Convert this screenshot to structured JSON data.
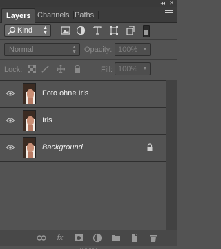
{
  "header": {
    "collapse_glyph": "◂◂",
    "close_glyph": "✕",
    "menu_icon": "panel-menu-icon"
  },
  "tabs": [
    {
      "label": "Layers",
      "active": true
    },
    {
      "label": "Channels",
      "active": false
    },
    {
      "label": "Paths",
      "active": false
    }
  ],
  "filter": {
    "kind_label": "Kind",
    "icons": [
      "pixel-filter-icon",
      "adjustment-filter-icon",
      "type-filter-icon",
      "shape-filter-icon",
      "smart-object-filter-icon"
    ]
  },
  "blend": {
    "mode": "Normal",
    "opacity_label": "Opacity:",
    "opacity_value": "100%"
  },
  "lock": {
    "label": "Lock:",
    "fill_label": "Fill:",
    "fill_value": "100%"
  },
  "layers": [
    {
      "name": "Foto ohne Iris",
      "visible": true,
      "locked": false,
      "italic": false
    },
    {
      "name": "Iris",
      "visible": true,
      "locked": false,
      "italic": false
    },
    {
      "name": "Background",
      "visible": true,
      "locked": true,
      "italic": true
    }
  ],
  "footer": {
    "icons": [
      "link-layers-icon",
      "fx-icon",
      "add-mask-icon",
      "adjustment-layer-icon",
      "new-group-icon",
      "new-layer-icon",
      "delete-layer-icon"
    ],
    "fx_label": "fx"
  },
  "colors": {
    "panel_bg": "#535353",
    "dark_bar": "#3c3c3c",
    "text": "#e6e6e6"
  }
}
